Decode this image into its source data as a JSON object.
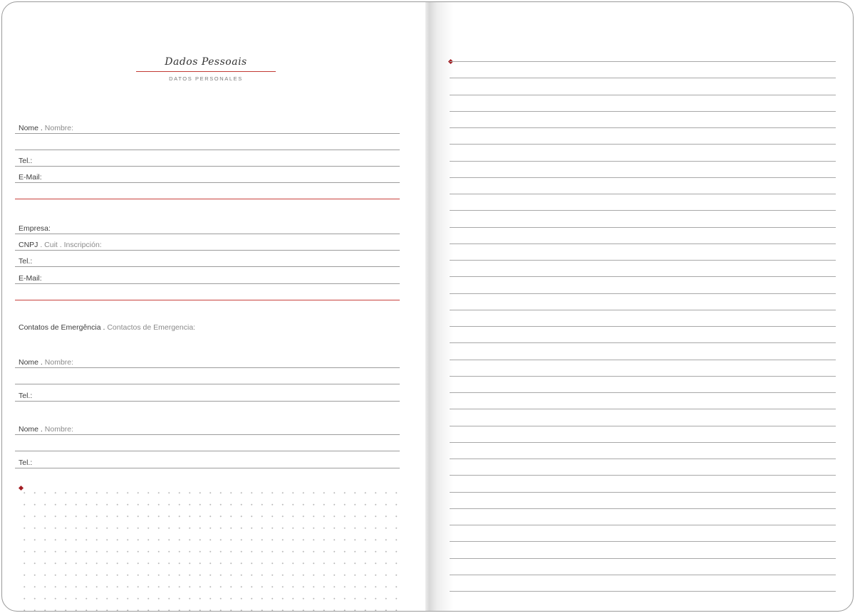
{
  "header": {
    "title": "Dados Pessoais",
    "subtitle": "DATOS PERSONALES"
  },
  "personal": {
    "name_pt": "Nome",
    "name_sep": " . ",
    "name_es": "Nombre:",
    "tel": "Tel.:",
    "email": "E-Mail:"
  },
  "company": {
    "empresa": "Empresa:",
    "cnpj_pt": "CNPJ",
    "cnpj_es": " . Cuit . Inscripción:",
    "tel": "Tel.:",
    "email": "E-Mail:"
  },
  "emergency": {
    "heading_pt": "Contatos de Emergência",
    "heading_sep": " . ",
    "heading_es": "Contactos de Emergencia:",
    "contact1_name_pt": "Nome",
    "contact1_name_sep": " . ",
    "contact1_name_es": "Nombre:",
    "contact1_tel": "Tel.:",
    "contact2_name_pt": "Nome",
    "contact2_name_sep": " . ",
    "contact2_name_es": "Nombre:",
    "contact2_tel": "Tel.:"
  },
  "colors": {
    "accent_red": "#c23a35",
    "diamond_red": "#a31d23",
    "rule_gray": "#9c9c9c"
  }
}
